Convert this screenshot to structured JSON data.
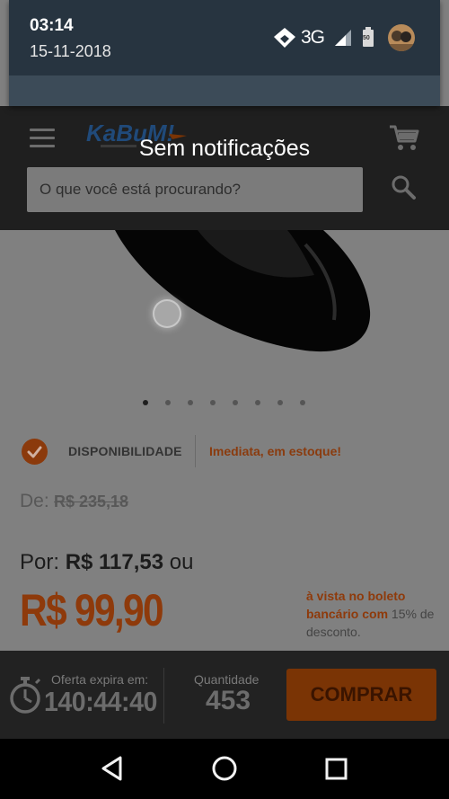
{
  "status_bar": {
    "time": "03:14",
    "date": "15-11-2018",
    "network": "3G",
    "battery_text": "50"
  },
  "notifications": {
    "empty_message": "Sem notificações"
  },
  "header": {
    "logo_text": "KaBuM!",
    "search_placeholder": "O que você está procurando?",
    "menu_icon": "hamburger-menu-icon",
    "cart_icon": "cart-icon",
    "search_icon": "search-icon"
  },
  "product": {
    "image_carousel": {
      "total_dots": 8,
      "active_index": 0
    },
    "availability_label": "DISPONIBILIDADE",
    "availability_value": "Imediata, em estoque!",
    "old_price_label": "De:",
    "old_price_value": "R$ 235,18",
    "price_prefix": "Por:",
    "price_value": "R$ 117,53",
    "price_suffix": "ou",
    "cash_price": "R$ 99,90",
    "boleto_text_accent": "à vista no boleto bancário com",
    "boleto_text_rest": "15% de desconto."
  },
  "buy_bar": {
    "expire_label": "Oferta expira em:",
    "expire_value": "140:44:40",
    "quantity_label": "Quantidade",
    "quantity_value": "453",
    "buy_label": "COMPRAR"
  },
  "colors": {
    "accent": "#8e3a0b",
    "shade": "#273440",
    "header_bg": "#1f1f1f",
    "page_dim": "#808080"
  }
}
